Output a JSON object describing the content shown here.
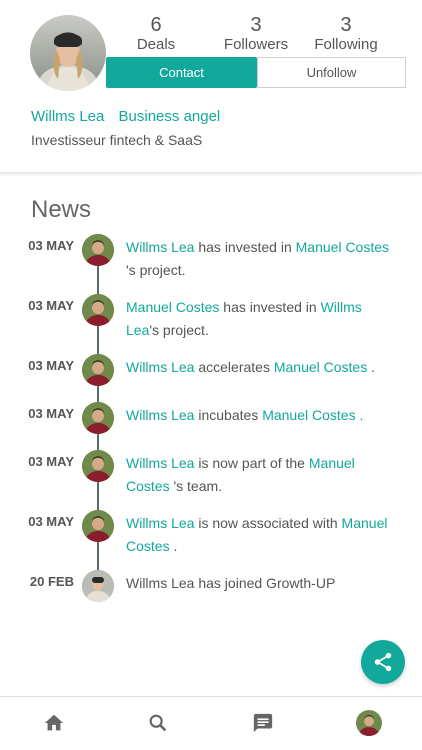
{
  "profile": {
    "stats": [
      {
        "value": "6",
        "label": "Deals"
      },
      {
        "value": "3",
        "label": "Followers"
      },
      {
        "value": "3",
        "label": "Following"
      }
    ],
    "contact_label": "Contact",
    "unfollow_label": "Unfollow",
    "name": "Willms Lea",
    "role": "Business angel",
    "bio": "Investisseur fintech & SaaS"
  },
  "news": {
    "title": "News",
    "items": [
      {
        "date": "03 MAY",
        "parts": [
          {
            "t": "Willms Lea",
            "link": true
          },
          {
            "t": " has invested in ",
            "link": false
          },
          {
            "t": "Manuel Costes",
            "link": true
          },
          {
            "t": " 's project.",
            "link": false
          }
        ]
      },
      {
        "date": "03 MAY",
        "parts": [
          {
            "t": "Manuel Costes",
            "link": true
          },
          {
            "t": " has invested in ",
            "link": false
          },
          {
            "t": "Willms Lea",
            "link": true
          },
          {
            "t": "'s project.",
            "link": false
          }
        ]
      },
      {
        "date": "03 MAY",
        "parts": [
          {
            "t": "Willms Lea",
            "link": true
          },
          {
            "t": " accelerates ",
            "link": false
          },
          {
            "t": "Manuel Costes",
            "link": true
          },
          {
            "t": " .",
            "link": false
          }
        ]
      },
      {
        "date": "03 MAY",
        "parts": [
          {
            "t": "Willms Lea",
            "link": true
          },
          {
            "t": " incubates ",
            "link": false
          },
          {
            "t": "Manuel Costes",
            "link": true
          },
          {
            "t": " .",
            "link": true
          }
        ]
      },
      {
        "date": "03 MAY",
        "parts": [
          {
            "t": "Willms Lea",
            "link": true
          },
          {
            "t": " is now part of the ",
            "link": false
          },
          {
            "t": "Manuel Costes",
            "link": true
          },
          {
            "t": " 's team.",
            "link": false
          }
        ]
      },
      {
        "date": "03 MAY",
        "parts": [
          {
            "t": "Willms Lea",
            "link": true
          },
          {
            "t": " is now associated with ",
            "link": false
          },
          {
            "t": "Manuel Costes",
            "link": true
          },
          {
            "t": " .",
            "link": false
          }
        ]
      },
      {
        "date": "20 FEB",
        "parts": [
          {
            "t": "Willms Lea has joined Growth-UP",
            "link": false
          }
        ]
      }
    ]
  },
  "fab": {
    "icon": "share-icon"
  },
  "bottom_nav": [
    {
      "icon": "home-icon"
    },
    {
      "icon": "search-icon"
    },
    {
      "icon": "message-icon"
    },
    {
      "icon": "profile-avatar"
    }
  ],
  "colors": {
    "accent": "#12a89b",
    "text": "#555555"
  }
}
